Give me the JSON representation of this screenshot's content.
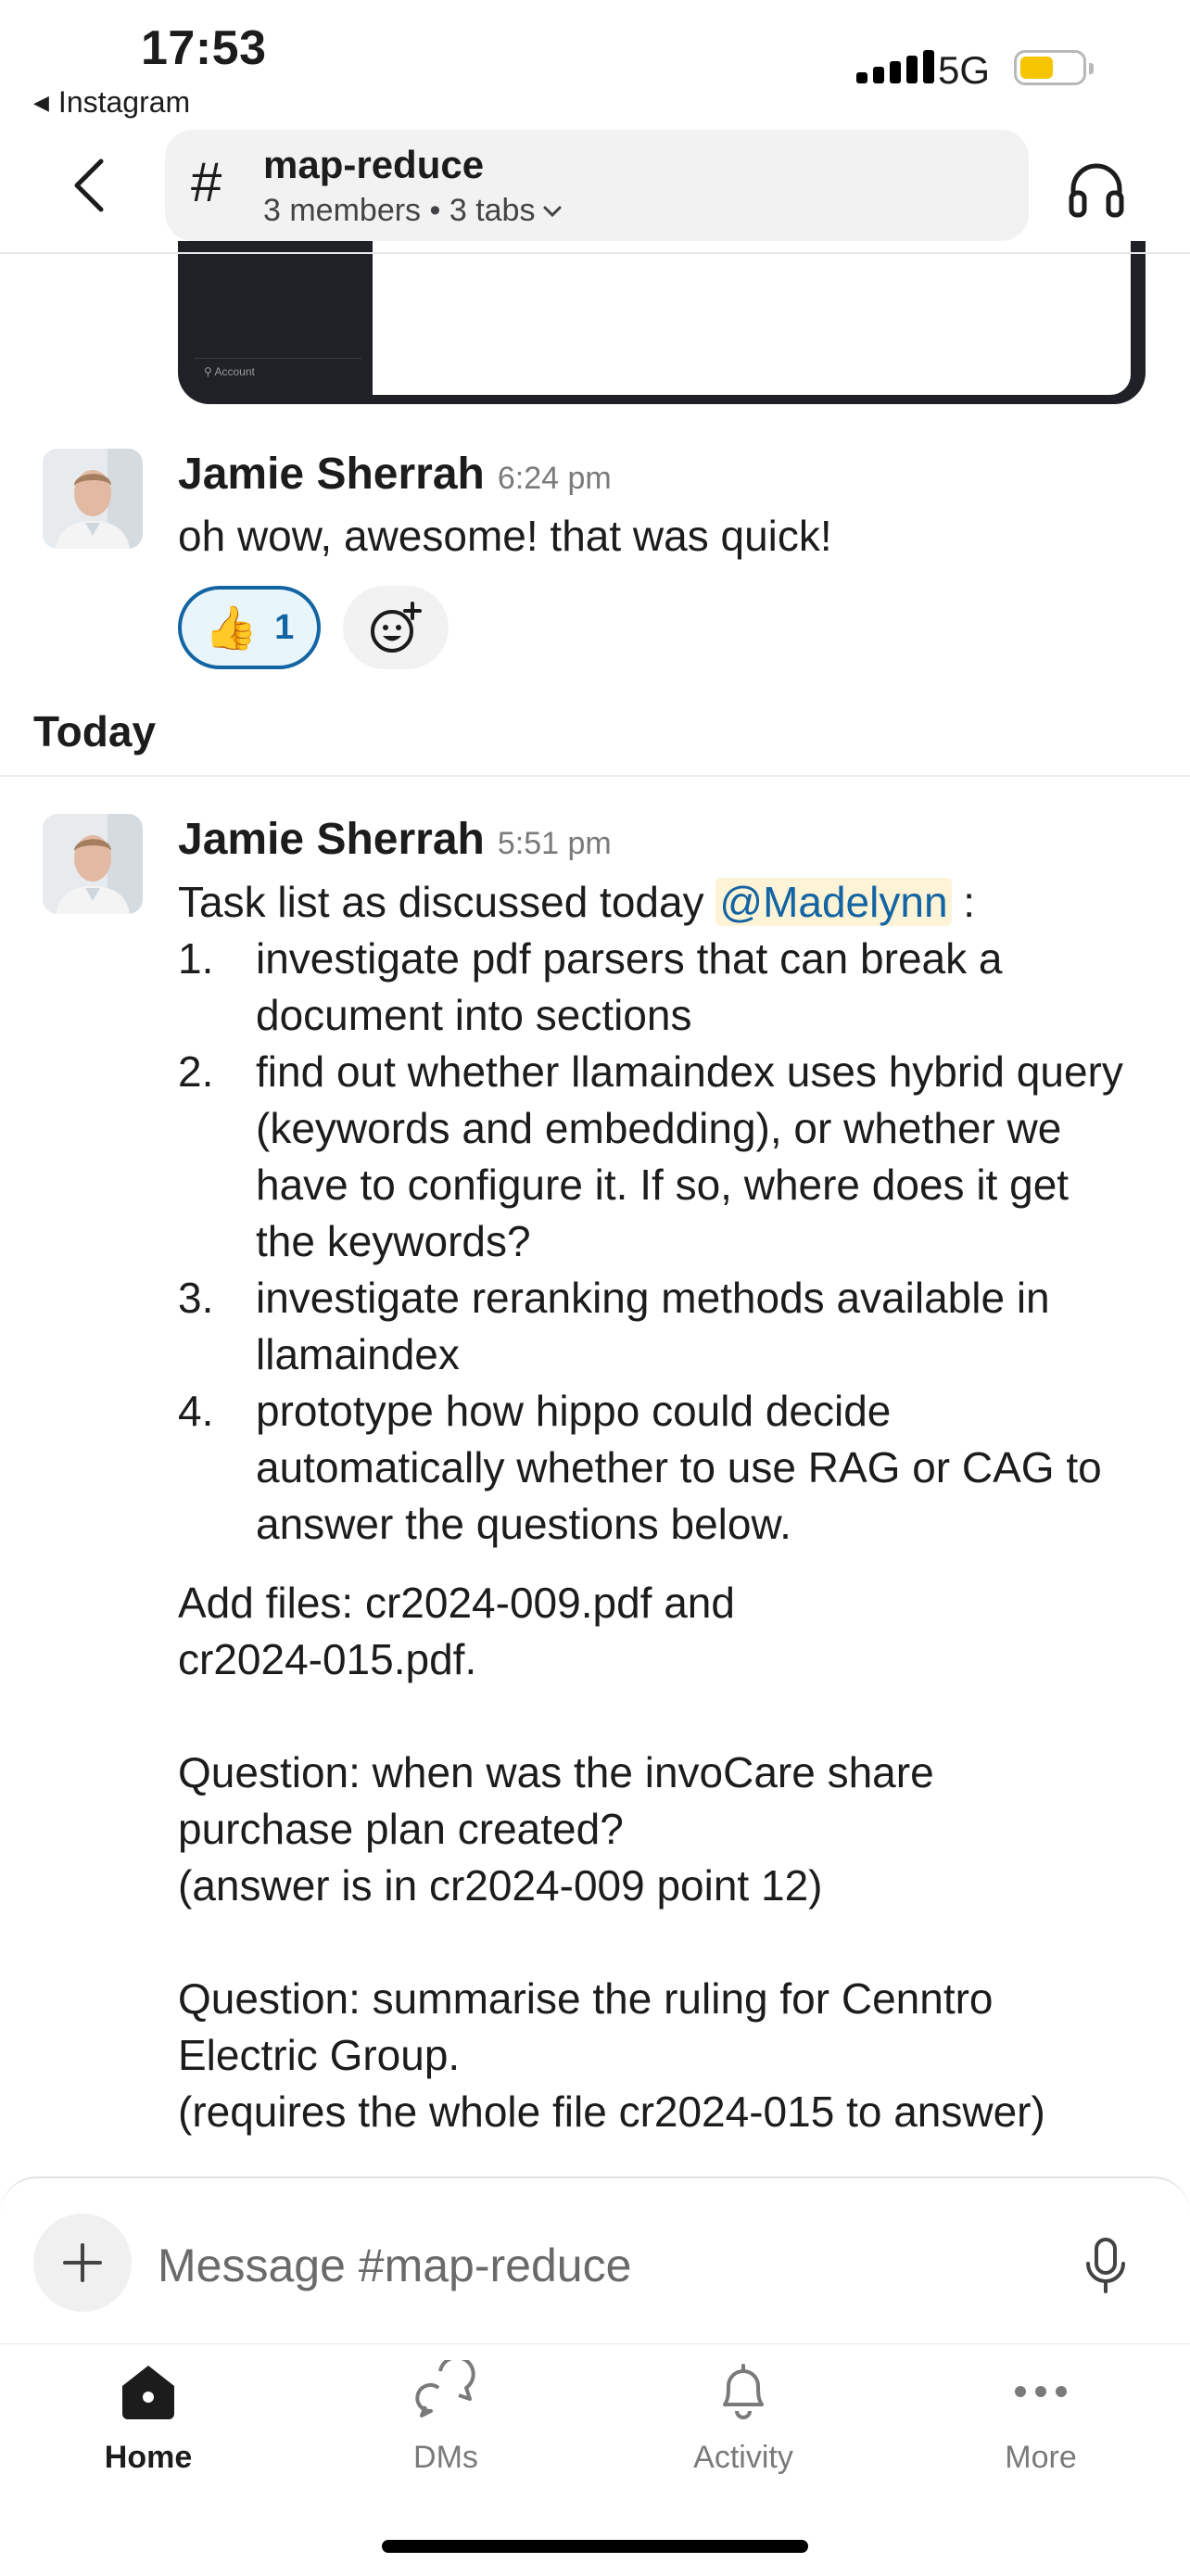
{
  "status_bar": {
    "time": "17:53",
    "back_app": "Instagram",
    "network": "5G",
    "battery_level": 0.55
  },
  "header": {
    "channel_name": "map-reduce",
    "meta": "3 members • 3 tabs"
  },
  "attachment": {
    "caption": "Account"
  },
  "messages": [
    {
      "sender": "Jamie Sherrah",
      "time": "6:24 pm",
      "text": "oh wow, awesome! that was quick!",
      "reactions": [
        {
          "emoji": "👍",
          "count": "1"
        }
      ]
    },
    {
      "sender": "Jamie Sherrah",
      "time": "5:51 pm",
      "intro": "Task list as discussed today",
      "mention": "@Madelynn",
      "intro_suffix": " :",
      "tasks": [
        {
          "num": "1.",
          "text": "investigate pdf parsers that can break a document into sections"
        },
        {
          "num": "2.",
          "text": "find out whether llamaindex uses hybrid query (keywords and embedding), or whether we have to configure it.  If so, where does it get the keywords?"
        },
        {
          "num": "3.",
          "text": "investigate reranking methods available in llamaindex"
        },
        {
          "num": "4.",
          "text": "prototype how hippo could decide automatically whether to use RAG or CAG to answer the questions below."
        }
      ],
      "para1": [
        "Add files: cr2024-009.pdf and",
        "cr2024-015.pdf."
      ],
      "para2": [
        "Question: when was the invoCare share",
        "purchase plan created?",
        "(answer is in cr2024-009 point 12)"
      ],
      "para3": [
        "Question: summarise the ruling for Cenntro",
        "Electric Group.",
        "(requires the whole file cr2024-015 to answer)"
      ]
    }
  ],
  "divider_label": "Today",
  "composer": {
    "placeholder": "Message #map-reduce"
  },
  "tabs": [
    {
      "label": "Home",
      "active": true
    },
    {
      "label": "DMs",
      "active": false
    },
    {
      "label": "Activity",
      "active": false
    },
    {
      "label": "More",
      "active": false
    }
  ],
  "colors": {
    "link": "#1264a3",
    "mention_bg": "#fdf3d6",
    "battery": "#f6c500"
  }
}
